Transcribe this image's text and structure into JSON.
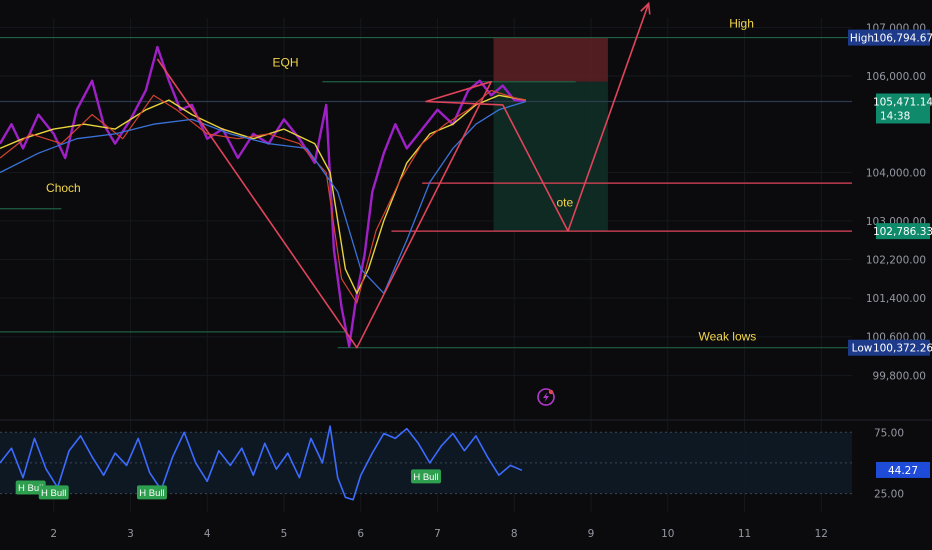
{
  "chart_data": [
    {
      "type": "line",
      "panel": "price",
      "ylim": [
        99600,
        107200
      ],
      "xlim": [
        1.3,
        12.4
      ],
      "x_ticks": [
        "2",
        "3",
        "4",
        "5",
        "6",
        "7",
        "8",
        "9",
        "10",
        "11",
        "12"
      ],
      "y_ticks": [
        {
          "value": 107000,
          "label": "107,000.00"
        },
        {
          "value": 106000,
          "label": "106,000.00"
        },
        {
          "value": 104000,
          "label": "104,000.00"
        },
        {
          "value": 103000,
          "label": "103,000.00"
        },
        {
          "value": 102200,
          "label": "102,200.00"
        },
        {
          "value": 101400,
          "label": "101,400.00"
        },
        {
          "value": 100600,
          "label": "100,600.00"
        },
        {
          "value": 99800,
          "label": "99,800.00"
        }
      ],
      "price_tags": [
        {
          "id": "high",
          "value": 106794.67,
          "prefix": "High",
          "label": "106,794.67",
          "color": "#1e3a8a"
        },
        {
          "id": "current",
          "value": 105471.14,
          "label": "105,471.14",
          "sub": "14:38",
          "color": "#0f8a6b"
        },
        {
          "id": "ote",
          "value": 102786.33,
          "label": "102,786.33",
          "color": "#0f8a6b"
        },
        {
          "id": "low",
          "value": 100372.26,
          "prefix": "Low",
          "label": "100,372.26",
          "color": "#1e3a8a"
        }
      ],
      "annotations": [
        {
          "text": "High",
          "x": 10.8,
          "y": 107000
        },
        {
          "text": "EQH",
          "x": 4.85,
          "y": 106200
        },
        {
          "text": "Choch",
          "x": 1.9,
          "y": 103600
        },
        {
          "text": "ote",
          "x": 8.55,
          "y": 103300
        },
        {
          "text": "Weak lows",
          "x": 10.4,
          "y": 100520
        }
      ],
      "levels": [
        {
          "y": 106794.67,
          "x1": 1.3,
          "x2": 12.4,
          "color": "#1f5f44"
        },
        {
          "y": 105880,
          "x1": 5.5,
          "x2": 8.8,
          "color": "#1f5f44"
        },
        {
          "y": 105471,
          "x1": 1.3,
          "x2": 12.4,
          "color": "#2d3b4f"
        },
        {
          "y": 103250,
          "x1": 1.3,
          "x2": 2.1,
          "color": "#1f5f44"
        },
        {
          "y": 100700,
          "x1": 1.3,
          "x2": 5.8,
          "color": "#1f5f44"
        },
        {
          "y": 100372.26,
          "x1": 5.7,
          "x2": 12.4,
          "color": "#1f5f44"
        },
        {
          "y": 103780,
          "x1": 6.8,
          "x2": 12.4,
          "color": "#e0445a"
        },
        {
          "y": 102786.33,
          "x1": 6.4,
          "x2": 12.4,
          "color": "#e0445a"
        }
      ],
      "trade_boxes": [
        {
          "kind": "stop",
          "x1": 7.73,
          "x2": 9.22,
          "y1": 106794.67,
          "y2": 105880,
          "color": "#5a1f24"
        },
        {
          "kind": "target",
          "x1": 7.73,
          "x2": 9.22,
          "y1": 105880,
          "y2": 102786.33,
          "color": "#0f2e26"
        }
      ],
      "projection_path": [
        [
          3.35,
          106350
        ],
        [
          5.95,
          100372
        ],
        [
          7.7,
          105880
        ],
        [
          6.85,
          105470
        ],
        [
          7.85,
          105400
        ],
        [
          8.7,
          102786
        ],
        [
          9.75,
          107500
        ]
      ],
      "series": [
        {
          "name": "",
          "color": "#a020c8",
          "width": 2.4,
          "values": [
            [
              1.3,
              104600
            ],
            [
              1.45,
              105000
            ],
            [
              1.6,
              104500
            ],
            [
              1.8,
              105200
            ],
            [
              2.0,
              104800
            ],
            [
              2.15,
              104300
            ],
            [
              2.3,
              105300
            ],
            [
              2.5,
              105900
            ],
            [
              2.65,
              105000
            ],
            [
              2.8,
              104600
            ],
            [
              3.0,
              105100
            ],
            [
              3.2,
              105700
            ],
            [
              3.35,
              106600
            ],
            [
              3.5,
              105900
            ],
            [
              3.65,
              105300
            ],
            [
              3.8,
              105400
            ],
            [
              4.0,
              104700
            ],
            [
              4.2,
              104900
            ],
            [
              4.4,
              104300
            ],
            [
              4.6,
              104800
            ],
            [
              4.8,
              104600
            ],
            [
              5.0,
              105100
            ],
            [
              5.2,
              104700
            ],
            [
              5.4,
              104200
            ],
            [
              5.55,
              105400
            ],
            [
              5.65,
              102400
            ],
            [
              5.75,
              101200
            ],
            [
              5.85,
              100400
            ],
            [
              5.95,
              101500
            ],
            [
              6.05,
              102300
            ],
            [
              6.15,
              103600
            ],
            [
              6.3,
              104400
            ],
            [
              6.45,
              105000
            ],
            [
              6.6,
              104500
            ],
            [
              6.8,
              104900
            ],
            [
              7.0,
              105300
            ],
            [
              7.2,
              105000
            ],
            [
              7.4,
              105700
            ],
            [
              7.55,
              105900
            ],
            [
              7.7,
              105600
            ],
            [
              7.85,
              105800
            ],
            [
              8.0,
              105500
            ],
            [
              8.15,
              105480
            ]
          ]
        },
        {
          "name": "",
          "color": "#e8d33a",
          "width": 1.4,
          "values": [
            [
              1.3,
              104500
            ],
            [
              1.6,
              104700
            ],
            [
              2.0,
              104900
            ],
            [
              2.4,
              105000
            ],
            [
              2.8,
              104900
            ],
            [
              3.2,
              105300
            ],
            [
              3.5,
              105500
            ],
            [
              3.8,
              105200
            ],
            [
              4.2,
              104900
            ],
            [
              4.6,
              104700
            ],
            [
              5.0,
              104900
            ],
            [
              5.4,
              104600
            ],
            [
              5.6,
              104000
            ],
            [
              5.8,
              102000
            ],
            [
              5.95,
              101500
            ],
            [
              6.1,
              102000
            ],
            [
              6.3,
              103000
            ],
            [
              6.6,
              104200
            ],
            [
              6.9,
              104800
            ],
            [
              7.2,
              105000
            ],
            [
              7.5,
              105400
            ],
            [
              7.8,
              105600
            ],
            [
              8.15,
              105500
            ]
          ]
        },
        {
          "name": "",
          "color": "#d4432f",
          "width": 1.2,
          "values": [
            [
              1.3,
              104300
            ],
            [
              1.7,
              104800
            ],
            [
              2.1,
              104600
            ],
            [
              2.5,
              105200
            ],
            [
              2.9,
              104700
            ],
            [
              3.3,
              105600
            ],
            [
              3.6,
              105300
            ],
            [
              4.0,
              104800
            ],
            [
              4.4,
              104700
            ],
            [
              4.8,
              104800
            ],
            [
              5.2,
              104600
            ],
            [
              5.55,
              104000
            ],
            [
              5.75,
              101800
            ],
            [
              5.95,
              101300
            ],
            [
              6.2,
              102800
            ],
            [
              6.5,
              103800
            ],
            [
              6.8,
              104600
            ],
            [
              7.1,
              105000
            ],
            [
              7.4,
              105300
            ],
            [
              7.7,
              105700
            ],
            [
              8.0,
              105550
            ],
            [
              8.15,
              105500
            ]
          ]
        },
        {
          "name": "",
          "color": "#3a72d8",
          "width": 1.3,
          "values": [
            [
              1.3,
              104000
            ],
            [
              1.8,
              104400
            ],
            [
              2.3,
              104700
            ],
            [
              2.8,
              104800
            ],
            [
              3.3,
              105000
            ],
            [
              3.8,
              105100
            ],
            [
              4.3,
              104800
            ],
            [
              4.8,
              104600
            ],
            [
              5.3,
              104500
            ],
            [
              5.7,
              103600
            ],
            [
              6.0,
              102000
            ],
            [
              6.3,
              101500
            ],
            [
              6.6,
              102600
            ],
            [
              6.9,
              103800
            ],
            [
              7.2,
              104500
            ],
            [
              7.5,
              105000
            ],
            [
              7.8,
              105300
            ],
            [
              8.15,
              105470
            ]
          ]
        }
      ]
    },
    {
      "type": "line",
      "panel": "rsi",
      "ylim": [
        10,
        85
      ],
      "xlim": [
        1.3,
        12.4
      ],
      "y_ticks": [
        {
          "value": 75,
          "label": "75.00"
        },
        {
          "value": 25,
          "label": "25.00"
        }
      ],
      "bands": [
        75,
        50,
        25
      ],
      "current_value": {
        "value": 44.27,
        "label": "44.27"
      },
      "labels": [
        {
          "text": "H Bull",
          "x": 1.7,
          "y": 30
        },
        {
          "text": "H Bull",
          "x": 2.0,
          "y": 26
        },
        {
          "text": "H Bull",
          "x": 3.28,
          "y": 26
        },
        {
          "text": "H Bull",
          "x": 6.85,
          "y": 39
        }
      ],
      "series": [
        {
          "name": "",
          "color": "#3d6bff",
          "values": [
            [
              1.3,
              50
            ],
            [
              1.45,
              62
            ],
            [
              1.6,
              38
            ],
            [
              1.75,
              70
            ],
            [
              1.9,
              45
            ],
            [
              2.05,
              30
            ],
            [
              2.2,
              60
            ],
            [
              2.35,
              72
            ],
            [
              2.5,
              55
            ],
            [
              2.65,
              40
            ],
            [
              2.8,
              58
            ],
            [
              2.95,
              48
            ],
            [
              3.1,
              70
            ],
            [
              3.25,
              42
            ],
            [
              3.4,
              28
            ],
            [
              3.55,
              55
            ],
            [
              3.7,
              75
            ],
            [
              3.85,
              50
            ],
            [
              4.0,
              35
            ],
            [
              4.15,
              60
            ],
            [
              4.3,
              48
            ],
            [
              4.45,
              62
            ],
            [
              4.6,
              40
            ],
            [
              4.75,
              66
            ],
            [
              4.9,
              45
            ],
            [
              5.05,
              58
            ],
            [
              5.2,
              38
            ],
            [
              5.35,
              70
            ],
            [
              5.5,
              50
            ],
            [
              5.6,
              80
            ],
            [
              5.7,
              38
            ],
            [
              5.8,
              22
            ],
            [
              5.9,
              20
            ],
            [
              6.0,
              40
            ],
            [
              6.15,
              58
            ],
            [
              6.3,
              74
            ],
            [
              6.45,
              70
            ],
            [
              6.6,
              78
            ],
            [
              6.75,
              66
            ],
            [
              6.9,
              50
            ],
            [
              7.05,
              64
            ],
            [
              7.2,
              74
            ],
            [
              7.35,
              60
            ],
            [
              7.5,
              72
            ],
            [
              7.65,
              55
            ],
            [
              7.8,
              40
            ],
            [
              7.95,
              48
            ],
            [
              8.1,
              44
            ]
          ]
        }
      ]
    }
  ],
  "header_icon": "lightning-bolt-icon"
}
